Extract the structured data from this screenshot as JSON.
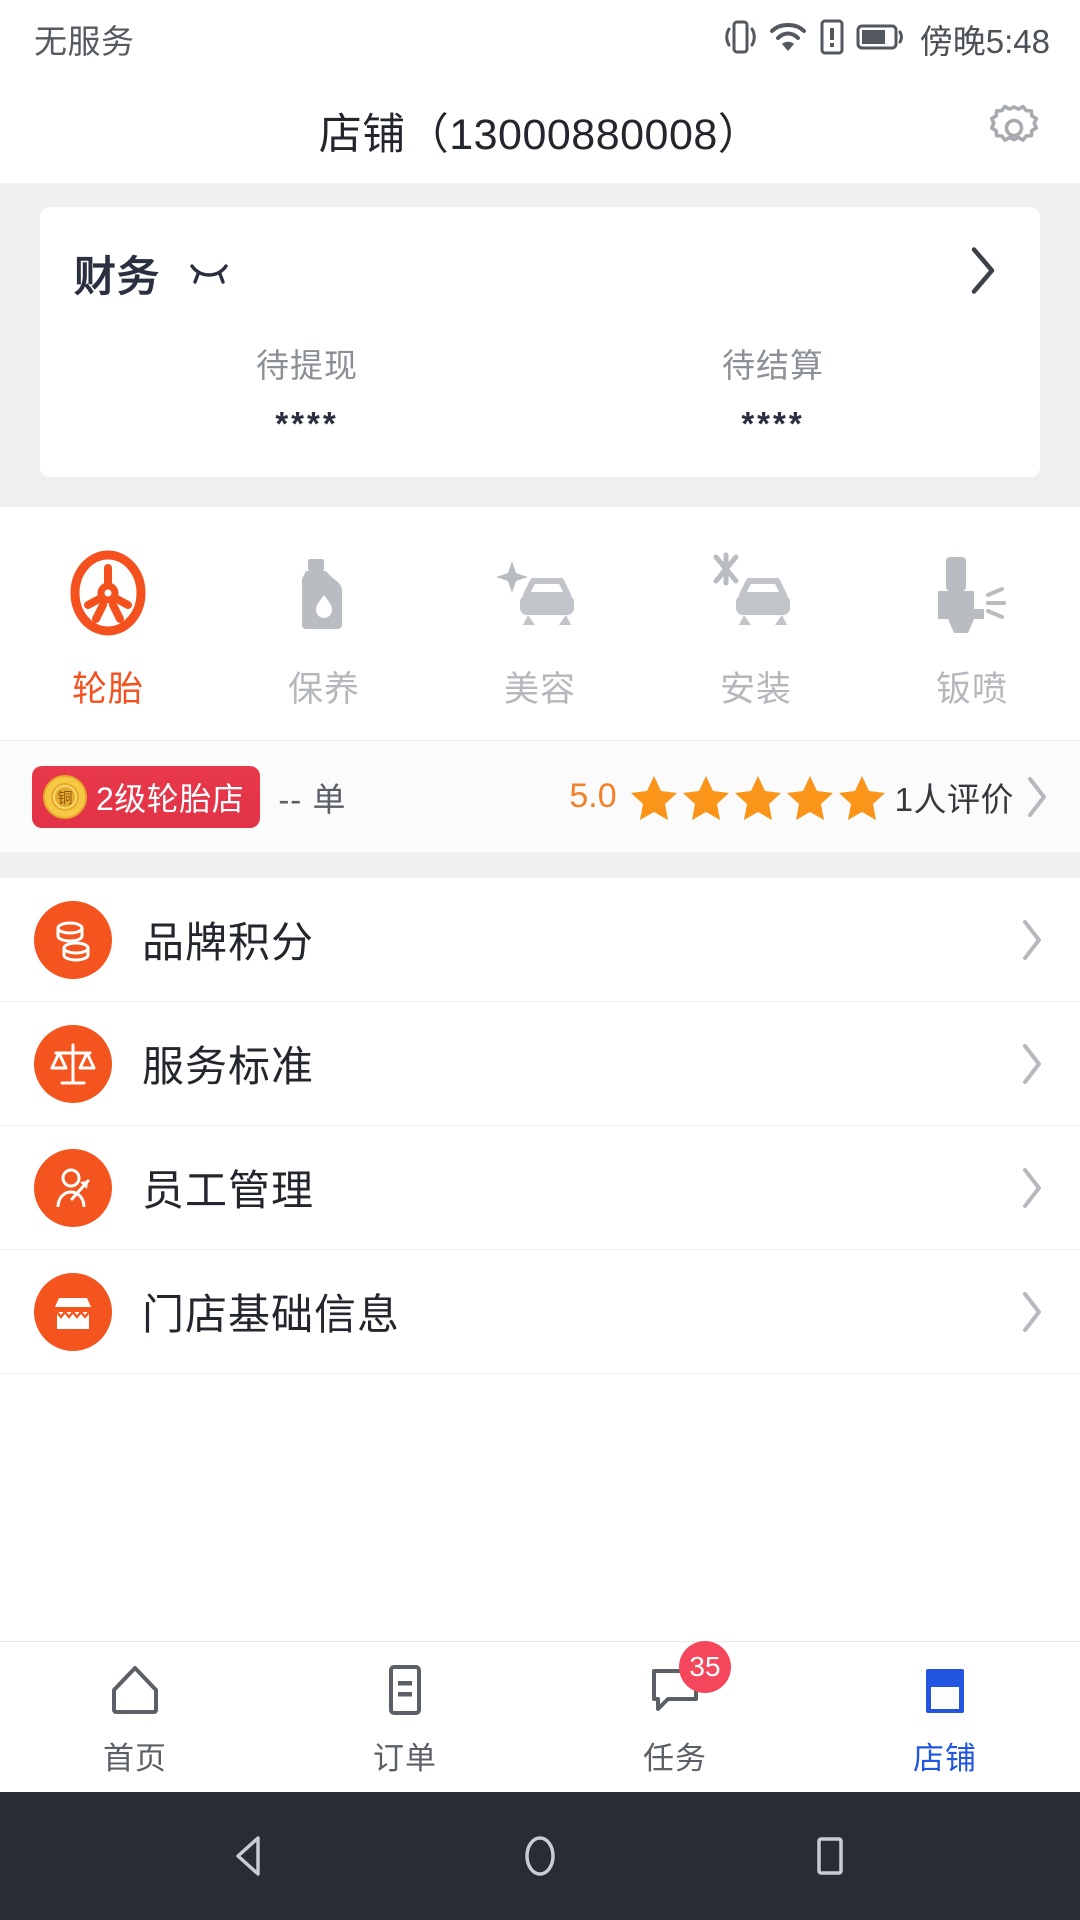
{
  "status_bar": {
    "carrier": "无服务",
    "time": "傍晚5:48",
    "icons": [
      "vibrate-icon",
      "wifi-icon",
      "sim-alert-icon",
      "battery-icon"
    ]
  },
  "header": {
    "title": "店铺（13000880008）",
    "settings_icon": "gear-icon"
  },
  "finance_card": {
    "title": "财务",
    "hide_icon": "eye-closed-icon",
    "chevron_icon": "chevron-right-icon",
    "stats": [
      {
        "label": "待提现",
        "value": "****"
      },
      {
        "label": "待结算",
        "value": "****"
      }
    ]
  },
  "categories": [
    {
      "label": "轮胎",
      "icon": "tire-icon",
      "active": true
    },
    {
      "label": "保养",
      "icon": "oil-bottle-icon",
      "active": false
    },
    {
      "label": "美容",
      "icon": "car-sparkle-icon",
      "active": false
    },
    {
      "label": "安装",
      "icon": "car-tools-icon",
      "active": false
    },
    {
      "label": "钣喷",
      "icon": "spray-gun-icon",
      "active": false
    }
  ],
  "shop_row": {
    "badge_medal_text": "铜",
    "badge_label": "2级轮胎店",
    "order_count": "-- 单",
    "rating_score": "5.0",
    "stars_filled": 5,
    "rating_count": "1人评价",
    "chevron_icon": "chevron-right-icon",
    "badge_color": "#e8384b",
    "accent_color": "#f4551e"
  },
  "menu": {
    "items": [
      {
        "label": "品牌积分",
        "icon": "coins-icon"
      },
      {
        "label": "服务标准",
        "icon": "scales-icon"
      },
      {
        "label": "员工管理",
        "icon": "employee-icon"
      },
      {
        "label": "门店基础信息",
        "icon": "storefront-icon"
      }
    ]
  },
  "tabbar": {
    "items": [
      {
        "label": "首页",
        "icon": "home-icon",
        "active": false,
        "badge": ""
      },
      {
        "label": "订单",
        "icon": "order-icon",
        "active": false,
        "badge": ""
      },
      {
        "label": "任务",
        "icon": "task-icon",
        "active": false,
        "badge": "35"
      },
      {
        "label": "店铺",
        "icon": "shop-icon",
        "active": true,
        "badge": ""
      }
    ],
    "active_color": "#2255e0"
  },
  "android_nav": {
    "back_icon": "back-triangle-icon",
    "home_icon": "home-circle-icon",
    "recents_icon": "recents-square-icon"
  }
}
